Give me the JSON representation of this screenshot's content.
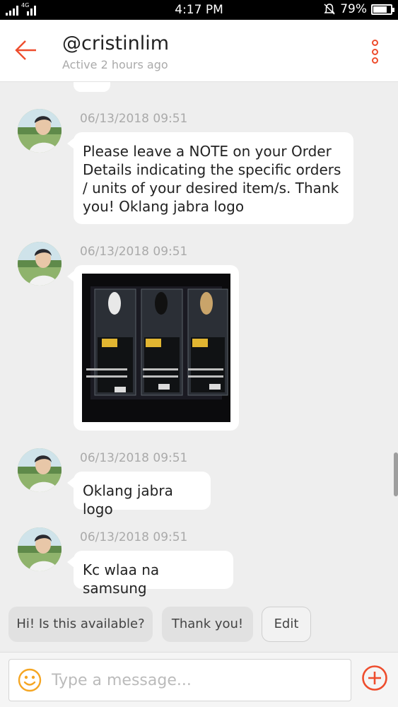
{
  "status_bar": {
    "network": "4G",
    "time": "4:17 PM",
    "battery": "79%",
    "battery_level": 0.79
  },
  "header": {
    "username": "@cristinlim",
    "activity": "Active 2 hours ago"
  },
  "messages": [
    {
      "timestamp": "06/13/2018 09:51",
      "type": "text",
      "text": "Please leave a NOTE on your Order Details indicating the specific orders / units of your desired item/s. Thank you! Oklang jabra logo"
    },
    {
      "timestamp": "06/13/2018 09:51",
      "type": "image",
      "image_description": "photo of three Jabra Bluetooth headsets in packaging"
    },
    {
      "timestamp": "06/13/2018 09:51",
      "type": "text",
      "text": "Oklang jabra logo"
    },
    {
      "timestamp": "06/13/2018 09:51",
      "type": "text",
      "text": "Kc wlaa na samsung"
    }
  ],
  "quick_replies": [
    "Hi! Is this available?",
    "Thank you!",
    "Edit"
  ],
  "composer": {
    "placeholder": "Type a message..."
  },
  "colors": {
    "accent": "#ee4d2d",
    "emoji": "#f5a623",
    "background": "#eeeeee"
  }
}
